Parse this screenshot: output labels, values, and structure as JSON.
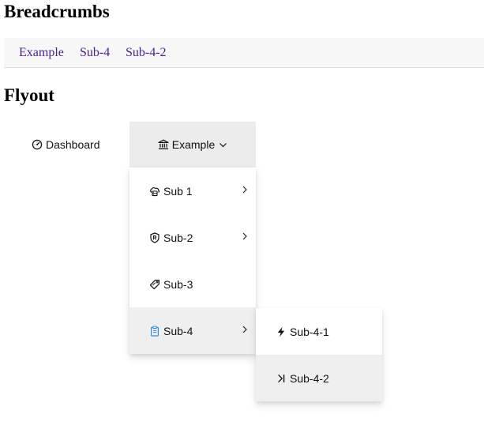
{
  "headings": {
    "breadcrumbs": "Breadcrumbs",
    "flyout": "Flyout"
  },
  "breadcrumbs": [
    "Example",
    "Sub-4",
    "Sub-4-2"
  ],
  "colors": {
    "link": "#4b1f8a",
    "active_bg": "#efefef",
    "top_active_bg": "#ececec",
    "sub4_icon": "#2b8de0"
  },
  "nav": {
    "dashboard": {
      "label": "Dashboard",
      "icon": "dashboard-icon"
    },
    "example": {
      "label": "Example",
      "icon": "bank-icon"
    }
  },
  "submenu": [
    {
      "label": "Sub 1",
      "icon": "cloud-server-icon",
      "has_children": true
    },
    {
      "label": "Sub-2",
      "icon": "shield-icon",
      "has_children": true
    },
    {
      "label": "Sub-3",
      "icon": "tag-icon",
      "has_children": false
    },
    {
      "label": "Sub-4",
      "icon": "clipboard-icon",
      "has_children": true,
      "active": true
    }
  ],
  "submenu2": [
    {
      "label": "Sub-4-1",
      "icon": "bolt-icon"
    },
    {
      "label": "Sub-4-2",
      "icon": "step-forward-icon",
      "active": true
    }
  ]
}
